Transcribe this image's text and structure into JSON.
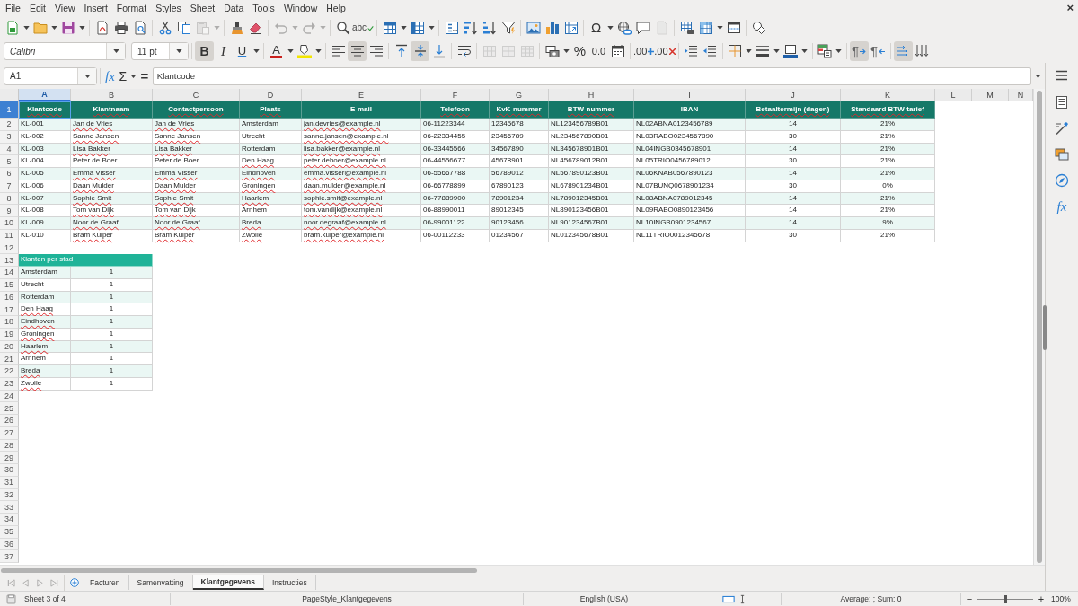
{
  "menu_bar": {
    "items": [
      "File",
      "Edit",
      "View",
      "Insert",
      "Format",
      "Styles",
      "Sheet",
      "Data",
      "Tools",
      "Window",
      "Help"
    ],
    "close": "×"
  },
  "standard_toolbar": {
    "groups": [
      [
        {
          "kind": "icon",
          "disabled": false
        },
        {
          "kind": "caret",
          "disabled": false
        },
        {
          "kind": "icon",
          "disabled": false
        },
        {
          "kind": "caret",
          "disabled": false
        },
        {
          "kind": "icon",
          "disabled": false
        },
        {
          "kind": "caret",
          "disabled": false
        }
      ],
      [
        {
          "kind": "icon",
          "disabled": false
        },
        {
          "kind": "icon",
          "disabled": false
        },
        {
          "kind": "icon",
          "disabled": false
        }
      ],
      [
        {
          "kind": "icon",
          "disabled": false
        },
        {
          "kind": "icon",
          "disabled": false
        },
        {
          "kind": "icon",
          "disabled": true
        },
        {
          "kind": "caret",
          "disabled": true
        }
      ],
      [
        {
          "kind": "icon",
          "disabled": false
        },
        {
          "kind": "icon",
          "disabled": false
        }
      ],
      [
        {
          "kind": "icon",
          "disabled": true
        },
        {
          "kind": "caret",
          "disabled": true
        },
        {
          "kind": "icon",
          "disabled": true
        },
        {
          "kind": "caret",
          "disabled": true
        }
      ],
      [
        {
          "kind": "icon",
          "disabled": false
        },
        {
          "kind": "glyph",
          "label": "abc",
          "disabled": false
        }
      ],
      [
        {
          "kind": "icon",
          "disabled": false
        },
        {
          "kind": "caret",
          "disabled": false
        },
        {
          "kind": "icon",
          "disabled": false
        },
        {
          "kind": "caret",
          "disabled": false
        }
      ],
      [
        {
          "kind": "icon",
          "disabled": false
        },
        {
          "kind": "icon",
          "disabled": false
        },
        {
          "kind": "icon",
          "disabled": false
        },
        {
          "kind": "icon",
          "disabled": false
        }
      ],
      [
        {
          "kind": "icon",
          "disabled": false
        },
        {
          "kind": "icon",
          "disabled": false
        },
        {
          "kind": "icon",
          "disabled": false
        }
      ],
      [
        {
          "kind": "glyph",
          "label": "Ω",
          "disabled": false
        },
        {
          "kind": "caret",
          "disabled": false
        },
        {
          "kind": "icon",
          "disabled": false
        },
        {
          "kind": "icon",
          "disabled": false
        },
        {
          "kind": "icon",
          "disabled": true
        }
      ],
      [
        {
          "kind": "icon",
          "disabled": false
        },
        {
          "kind": "icon",
          "disabled": false
        },
        {
          "kind": "caret",
          "disabled": false
        },
        {
          "kind": "icon",
          "disabled": false
        }
      ],
      [
        {
          "kind": "icon",
          "disabled": false
        }
      ]
    ]
  },
  "formatting_toolbar": {
    "font_name": "Calibri",
    "font_size": "11 pt",
    "groups": [
      [
        {
          "kind": "glyph",
          "label": "B",
          "on": true,
          "disabled": false
        },
        {
          "kind": "glyph",
          "label": "I",
          "on": false,
          "disabled": false
        },
        {
          "kind": "glyph",
          "label": "U",
          "on": false,
          "disabled": false
        },
        {
          "kind": "caret",
          "on": false,
          "disabled": false
        }
      ],
      [
        {
          "kind": "glyph",
          "label": "A",
          "on": false,
          "disabled": false
        },
        {
          "kind": "caret",
          "on": false,
          "disabled": false
        },
        {
          "kind": "icon",
          "on": false,
          "disabled": false
        },
        {
          "kind": "caret",
          "on": false,
          "disabled": false
        }
      ],
      [
        {
          "kind": "icon",
          "on": false,
          "disabled": false
        },
        {
          "kind": "icon",
          "on": true,
          "disabled": false
        },
        {
          "kind": "icon",
          "on": false,
          "disabled": false
        }
      ],
      [
        {
          "kind": "icon",
          "on": false,
          "disabled": false
        },
        {
          "kind": "icon",
          "on": true,
          "disabled": false
        },
        {
          "kind": "icon",
          "on": false,
          "disabled": false
        }
      ],
      [
        {
          "kind": "icon",
          "on": false,
          "disabled": false
        }
      ],
      [
        {
          "kind": "icon",
          "on": false,
          "disabled": true
        },
        {
          "kind": "icon",
          "on": false,
          "disabled": true
        },
        {
          "kind": "icon",
          "on": false,
          "disabled": true
        }
      ],
      [
        {
          "kind": "icon",
          "on": false,
          "disabled": false
        },
        {
          "kind": "caret",
          "on": false,
          "disabled": false
        },
        {
          "kind": "glyph",
          "label": "%",
          "on": false,
          "disabled": false
        },
        {
          "kind": "glyph",
          "label": "0.0",
          "on": false,
          "disabled": false
        },
        {
          "kind": "icon",
          "on": false,
          "disabled": false
        }
      ],
      [
        {
          "kind": "glyph",
          "label": ".00",
          "on": false,
          "disabled": false
        },
        {
          "kind": "glyph",
          "label": ".00",
          "on": false,
          "disabled": false
        }
      ],
      [
        {
          "kind": "icon",
          "on": false,
          "disabled": false
        },
        {
          "kind": "icon",
          "on": false,
          "disabled": false
        }
      ],
      [
        {
          "kind": "icon",
          "on": false,
          "disabled": false
        },
        {
          "kind": "caret",
          "on": false,
          "disabled": false
        },
        {
          "kind": "icon",
          "on": false,
          "disabled": false
        },
        {
          "kind": "caret",
          "on": false,
          "disabled": false
        },
        {
          "kind": "icon",
          "on": false,
          "disabled": false
        },
        {
          "kind": "caret",
          "on": false,
          "disabled": false
        }
      ],
      [
        {
          "kind": "icon",
          "on": false,
          "disabled": false
        },
        {
          "kind": "caret",
          "on": false,
          "disabled": false
        }
      ],
      [
        {
          "kind": "glyph",
          "label": "¶",
          "on": true,
          "disabled": false
        },
        {
          "kind": "glyph",
          "label": "¶",
          "on": false,
          "disabled": false
        }
      ],
      [
        {
          "kind": "icon",
          "on": true,
          "disabled": false
        },
        {
          "kind": "icon",
          "on": false,
          "disabled": false
        }
      ]
    ]
  },
  "formula_bar": {
    "cell_reference": "A1",
    "function_wizard": "fx",
    "sum": "Σ",
    "equals": "=",
    "content": "Klantcode"
  },
  "sidebar": {
    "buttons": [
      {
        "kind": "icon"
      },
      {
        "kind": "icon"
      },
      {
        "kind": "icon"
      },
      {
        "kind": "icon"
      },
      {
        "kind": "glyph",
        "label": "fx"
      }
    ]
  },
  "sheet": {
    "columns": [
      {
        "label": "A",
        "selected": true
      },
      {
        "label": "B",
        "selected": false
      },
      {
        "label": "C",
        "selected": false
      },
      {
        "label": "D",
        "selected": false
      },
      {
        "label": "E",
        "selected": false
      },
      {
        "label": "F",
        "selected": false
      },
      {
        "label": "G",
        "selected": false
      },
      {
        "label": "H",
        "selected": false
      },
      {
        "label": "I",
        "selected": false
      },
      {
        "label": "J",
        "selected": false
      },
      {
        "label": "K",
        "selected": false
      },
      {
        "label": "L",
        "selected": false
      },
      {
        "label": "M",
        "selected": false
      },
      {
        "label": "N",
        "selected": false
      }
    ],
    "row_numbers": [
      {
        "label": "1",
        "selected": true
      },
      {
        "label": "2",
        "selected": false
      },
      {
        "label": "3",
        "selected": false
      },
      {
        "label": "4",
        "selected": false
      },
      {
        "label": "5",
        "selected": false
      },
      {
        "label": "6",
        "selected": false
      },
      {
        "label": "7",
        "selected": false
      },
      {
        "label": "8",
        "selected": false
      },
      {
        "label": "9",
        "selected": false
      },
      {
        "label": "10",
        "selected": false
      },
      {
        "label": "11",
        "selected": false
      },
      {
        "label": "12",
        "selected": false
      },
      {
        "label": "13",
        "selected": false
      },
      {
        "label": "14",
        "selected": false
      },
      {
        "label": "15",
        "selected": false
      },
      {
        "label": "16",
        "selected": false
      },
      {
        "label": "17",
        "selected": false
      },
      {
        "label": "18",
        "selected": false
      },
      {
        "label": "19",
        "selected": false
      },
      {
        "label": "20",
        "selected": false
      },
      {
        "label": "21",
        "selected": false
      },
      {
        "label": "22",
        "selected": false
      },
      {
        "label": "23",
        "selected": false
      },
      {
        "label": "24",
        "selected": false
      },
      {
        "label": "25",
        "selected": false
      },
      {
        "label": "26",
        "selected": false
      },
      {
        "label": "27",
        "selected": false
      },
      {
        "label": "28",
        "selected": false
      },
      {
        "label": "29",
        "selected": false
      },
      {
        "label": "30",
        "selected": false
      },
      {
        "label": "31",
        "selected": false
      },
      {
        "label": "32",
        "selected": false
      },
      {
        "label": "33",
        "selected": false
      },
      {
        "label": "34",
        "selected": false
      },
      {
        "label": "35",
        "selected": false
      },
      {
        "label": "36",
        "selected": false
      },
      {
        "label": "37",
        "selected": false
      }
    ]
  },
  "customer_table": {
    "header": [
      {
        "text": "Klantcode",
        "misspelled": true
      },
      {
        "text": "Klantnaam",
        "misspelled": true
      },
      {
        "text": "Contactpersoon",
        "misspelled": true
      },
      {
        "text": "Plaats",
        "misspelled": true
      },
      {
        "text": "E-mail",
        "misspelled": false
      },
      {
        "text": "Telefoon",
        "misspelled": true
      },
      {
        "text": "KvK-nummer",
        "misspelled": true
      },
      {
        "text": "BTW-nummer",
        "misspelled": true
      },
      {
        "text": "IBAN",
        "misspelled": false
      },
      {
        "text": "Betaaltermijn (dagen)",
        "misspelled": true
      },
      {
        "text": "Standaard BTW-tarief",
        "misspelled": true
      }
    ],
    "rows": [
      [
        {
          "text": "KL-001",
          "misspelled": false
        },
        {
          "text": "Jan de Vries",
          "misspelled": true
        },
        {
          "text": "Jan de Vries",
          "misspelled": true
        },
        {
          "text": "Amsterdam",
          "misspelled": false
        },
        {
          "text": "jan.devries@example.nl",
          "misspelled": true
        },
        {
          "text": "06-11223344",
          "misspelled": false
        },
        {
          "text": "12345678",
          "misspelled": false
        },
        {
          "text": "NL123456789B01",
          "misspelled": false
        },
        {
          "text": "NL02ABNA0123456789",
          "misspelled": false
        },
        {
          "text": "14",
          "misspelled": false
        },
        {
          "text": "21%",
          "misspelled": false
        }
      ],
      [
        {
          "text": "KL-002",
          "misspelled": false
        },
        {
          "text": "Sanne Jansen",
          "misspelled": true
        },
        {
          "text": "Sanne Jansen",
          "misspelled": true
        },
        {
          "text": "Utrecht",
          "misspelled": false
        },
        {
          "text": "sanne.jansen@example.nl",
          "misspelled": true
        },
        {
          "text": "06-22334455",
          "misspelled": false
        },
        {
          "text": "23456789",
          "misspelled": false
        },
        {
          "text": "NL234567890B01",
          "misspelled": false
        },
        {
          "text": "NL03RABO0234567890",
          "misspelled": false
        },
        {
          "text": "30",
          "misspelled": false
        },
        {
          "text": "21%",
          "misspelled": false
        }
      ],
      [
        {
          "text": "KL-003",
          "misspelled": false
        },
        {
          "text": "Lisa Bakker",
          "misspelled": true
        },
        {
          "text": "Lisa Bakker",
          "misspelled": true
        },
        {
          "text": "Rotterdam",
          "misspelled": false
        },
        {
          "text": "lisa.bakker@example.nl",
          "misspelled": true
        },
        {
          "text": "06-33445566",
          "misspelled": false
        },
        {
          "text": "34567890",
          "misspelled": false
        },
        {
          "text": "NL345678901B01",
          "misspelled": false
        },
        {
          "text": "NL04INGB0345678901",
          "misspelled": false
        },
        {
          "text": "14",
          "misspelled": false
        },
        {
          "text": "21%",
          "misspelled": false
        }
      ],
      [
        {
          "text": "KL-004",
          "misspelled": false
        },
        {
          "text": "Peter de Boer",
          "misspelled": false
        },
        {
          "text": "Peter de Boer",
          "misspelled": false
        },
        {
          "text": "Den Haag",
          "misspelled": true
        },
        {
          "text": "peter.deboer@example.nl",
          "misspelled": true
        },
        {
          "text": "06-44556677",
          "misspelled": false
        },
        {
          "text": "45678901",
          "misspelled": false
        },
        {
          "text": "NL456789012B01",
          "misspelled": false
        },
        {
          "text": "NL05TRIO0456789012",
          "misspelled": false
        },
        {
          "text": "30",
          "misspelled": false
        },
        {
          "text": "21%",
          "misspelled": false
        }
      ],
      [
        {
          "text": "KL-005",
          "misspelled": false
        },
        {
          "text": "Emma Visser",
          "misspelled": true
        },
        {
          "text": "Emma Visser",
          "misspelled": true
        },
        {
          "text": "Eindhoven",
          "misspelled": true
        },
        {
          "text": "emma.visser@example.nl",
          "misspelled": true
        },
        {
          "text": "06-55667788",
          "misspelled": false
        },
        {
          "text": "56789012",
          "misspelled": false
        },
        {
          "text": "NL567890123B01",
          "misspelled": false
        },
        {
          "text": "NL06KNAB0567890123",
          "misspelled": false
        },
        {
          "text": "14",
          "misspelled": false
        },
        {
          "text": "21%",
          "misspelled": false
        }
      ],
      [
        {
          "text": "KL-006",
          "misspelled": false
        },
        {
          "text": "Daan Mulder",
          "misspelled": true
        },
        {
          "text": "Daan Mulder",
          "misspelled": true
        },
        {
          "text": "Groningen",
          "misspelled": true
        },
        {
          "text": "daan.mulder@example.nl",
          "misspelled": true
        },
        {
          "text": "06-66778899",
          "misspelled": false
        },
        {
          "text": "67890123",
          "misspelled": false
        },
        {
          "text": "NL678901234B01",
          "misspelled": false
        },
        {
          "text": "NL07BUNQ0678901234",
          "misspelled": false
        },
        {
          "text": "30",
          "misspelled": false
        },
        {
          "text": "0%",
          "misspelled": false
        }
      ],
      [
        {
          "text": "KL-007",
          "misspelled": false
        },
        {
          "text": "Sophie Smit",
          "misspelled": true
        },
        {
          "text": "Sophie Smit",
          "misspelled": true
        },
        {
          "text": "Haarlem",
          "misspelled": true
        },
        {
          "text": "sophie.smit@example.nl",
          "misspelled": true
        },
        {
          "text": "06-77889900",
          "misspelled": false
        },
        {
          "text": "78901234",
          "misspelled": false
        },
        {
          "text": "NL789012345B01",
          "misspelled": false
        },
        {
          "text": "NL08ABNA0789012345",
          "misspelled": false
        },
        {
          "text": "14",
          "misspelled": false
        },
        {
          "text": "21%",
          "misspelled": false
        }
      ],
      [
        {
          "text": "KL-008",
          "misspelled": false
        },
        {
          "text": "Tom van Dijk",
          "misspelled": true
        },
        {
          "text": "Tom van Dijk",
          "misspelled": true
        },
        {
          "text": "Arnhem",
          "misspelled": false
        },
        {
          "text": "tom.vandijk@example.nl",
          "misspelled": true
        },
        {
          "text": "06-88990011",
          "misspelled": false
        },
        {
          "text": "89012345",
          "misspelled": false
        },
        {
          "text": "NL890123456B01",
          "misspelled": false
        },
        {
          "text": "NL09RABO0890123456",
          "misspelled": false
        },
        {
          "text": "14",
          "misspelled": false
        },
        {
          "text": "21%",
          "misspelled": false
        }
      ],
      [
        {
          "text": "KL-009",
          "misspelled": false
        },
        {
          "text": "Noor de Graaf",
          "misspelled": true
        },
        {
          "text": "Noor de Graaf",
          "misspelled": true
        },
        {
          "text": "Breda",
          "misspelled": true
        },
        {
          "text": "noor.degraaf@example.nl",
          "misspelled": true
        },
        {
          "text": "06-99001122",
          "misspelled": false
        },
        {
          "text": "90123456",
          "misspelled": false
        },
        {
          "text": "NL901234567B01",
          "misspelled": false
        },
        {
          "text": "NL10INGB0901234567",
          "misspelled": false
        },
        {
          "text": "14",
          "misspelled": false
        },
        {
          "text": "9%",
          "misspelled": false
        }
      ],
      [
        {
          "text": "KL-010",
          "misspelled": false
        },
        {
          "text": "Bram Kuiper",
          "misspelled": true
        },
        {
          "text": "Bram Kuiper",
          "misspelled": true
        },
        {
          "text": "Zwolle",
          "misspelled": true
        },
        {
          "text": "bram.kuiper@example.nl",
          "misspelled": true
        },
        {
          "text": "06-00112233",
          "misspelled": false
        },
        {
          "text": "01234567",
          "misspelled": false
        },
        {
          "text": "NL012345678B01",
          "misspelled": false
        },
        {
          "text": "NL11TRIO0012345678",
          "misspelled": false
        },
        {
          "text": "30",
          "misspelled": false
        },
        {
          "text": "21%",
          "misspelled": false
        }
      ]
    ]
  },
  "city_summary": {
    "title": "Klanten per stad",
    "rows": [
      [
        {
          "text": "Amsterdam",
          "misspelled": false
        },
        {
          "text": "1",
          "misspelled": false
        }
      ],
      [
        {
          "text": "Utrecht",
          "misspelled": false
        },
        {
          "text": "1",
          "misspelled": false
        }
      ],
      [
        {
          "text": "Rotterdam",
          "misspelled": false
        },
        {
          "text": "1",
          "misspelled": false
        }
      ],
      [
        {
          "text": "Den Haag",
          "misspelled": true
        },
        {
          "text": "1",
          "misspelled": false
        }
      ],
      [
        {
          "text": "Eindhoven",
          "misspelled": true
        },
        {
          "text": "1",
          "misspelled": false
        }
      ],
      [
        {
          "text": "Groningen",
          "misspelled": true
        },
        {
          "text": "1",
          "misspelled": false
        }
      ],
      [
        {
          "text": "Haarlem",
          "misspelled": true
        },
        {
          "text": "1",
          "misspelled": false
        }
      ],
      [
        {
          "text": "Arnhem",
          "misspelled": false
        },
        {
          "text": "1",
          "misspelled": false
        }
      ],
      [
        {
          "text": "Breda",
          "misspelled": true
        },
        {
          "text": "1",
          "misspelled": false
        }
      ],
      [
        {
          "text": "Zwolle",
          "misspelled": true
        },
        {
          "text": "1",
          "misspelled": false
        }
      ]
    ]
  },
  "sheet_navigation": [
    {
      "disabled": true
    },
    {
      "disabled": true
    },
    {
      "disabled": true
    },
    {
      "disabled": true
    }
  ],
  "sheet_tabs": [
    {
      "label": "Facturen",
      "selected": false
    },
    {
      "label": "Samenvatting",
      "selected": false
    },
    {
      "label": "Klantgegevens",
      "selected": true
    },
    {
      "label": "Instructies",
      "selected": false
    }
  ],
  "status_bar": {
    "sheet_position": "Sheet 3 of 4",
    "page_style": "PageStyle_Klantgegevens",
    "language": "English (USA)",
    "selection_summary": "Average: ; Sum: 0",
    "zoom_out": "−",
    "zoom_in": "+",
    "zoom": {
      "level": 0.5,
      "value": "100%"
    }
  }
}
